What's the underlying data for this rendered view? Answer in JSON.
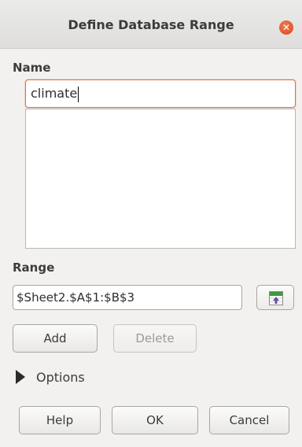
{
  "dialog": {
    "title": "Define Database Range",
    "close_symbol": "✕"
  },
  "name_section": {
    "label": "Name",
    "value": "climate",
    "list_items": []
  },
  "range_section": {
    "label": "Range",
    "value": "$Sheet2.$A$1:$B$3",
    "shrink_icon": "shrink-dialog-icon"
  },
  "buttons": {
    "add": "Add",
    "delete": "Delete",
    "help": "Help",
    "ok": "OK",
    "cancel": "Cancel"
  },
  "options": {
    "label": "Options",
    "expanded": false
  },
  "colors": {
    "focus_border": "#e0743f",
    "close_button": "#d9481d",
    "icon_green": "#3c9c3c"
  }
}
